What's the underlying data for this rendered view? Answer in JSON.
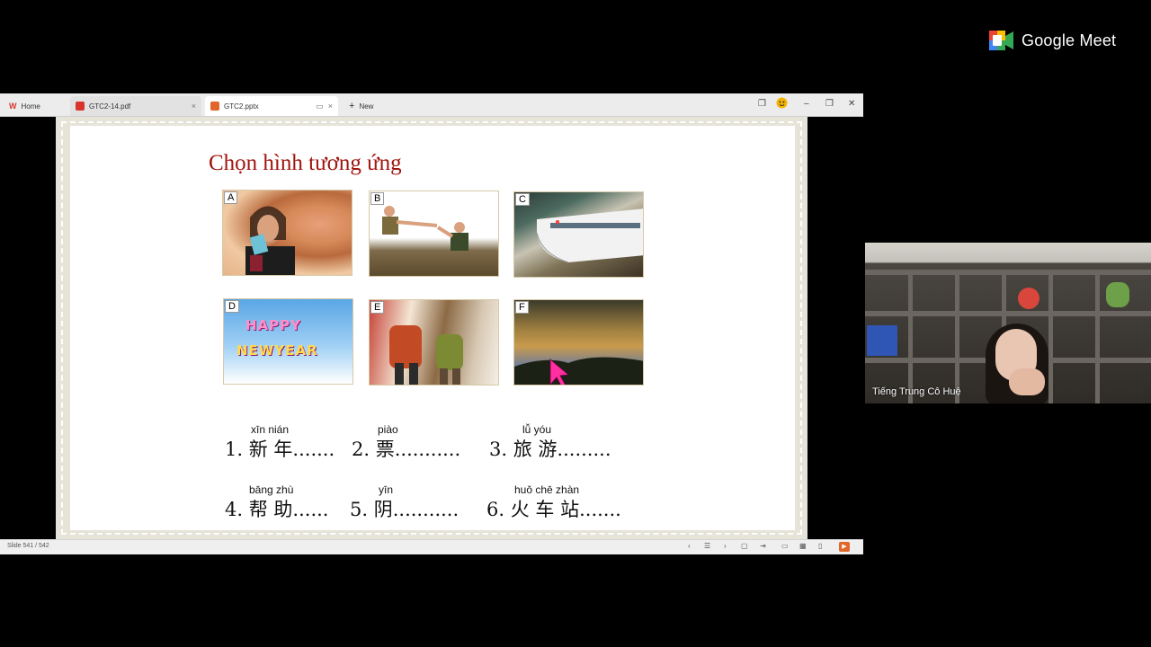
{
  "meet": {
    "brand": "Google Meet"
  },
  "tabs": [
    {
      "label": "Home"
    },
    {
      "label": "GTC2-14.pdf"
    },
    {
      "label": "GTC2.pptx"
    },
    {
      "label": "New"
    }
  ],
  "slide": {
    "title": "Chọn hình tương ứng",
    "pictures": [
      "A",
      "B",
      "C",
      "D",
      "E",
      "F"
    ],
    "hny_text": [
      "HAPPY",
      "NEWYEAR"
    ],
    "exercises": [
      {
        "num": "1.",
        "hanzi": "新 年",
        "pinyin": "xīn nián",
        "dots": "......."
      },
      {
        "num": "2.",
        "hanzi": "票",
        "pinyin": "piào",
        "dots": "..........."
      },
      {
        "num": "3.",
        "hanzi": "旅 游",
        "pinyin": "lǚ  yóu",
        "dots": "........."
      },
      {
        "num": "4.",
        "hanzi": "帮 助",
        "pinyin": "bāng zhù",
        "dots": "......"
      },
      {
        "num": "5.",
        "hanzi": "阴",
        "pinyin": "yīn",
        "dots": "..........."
      },
      {
        "num": "6.",
        "hanzi": "火 车 站",
        "pinyin": "huǒ chē zhàn",
        "dots": "......."
      }
    ]
  },
  "statusbar": {
    "slide_counter": "Slide 541 / 542"
  },
  "participant": {
    "name": "Tiếng Trung Cô Huệ"
  },
  "colors": {
    "title_red": "#a1140f",
    "tab_pdf_icon": "#d9342b",
    "tab_pptx_icon": "#e0662a",
    "home_icon": "#d9342b"
  }
}
